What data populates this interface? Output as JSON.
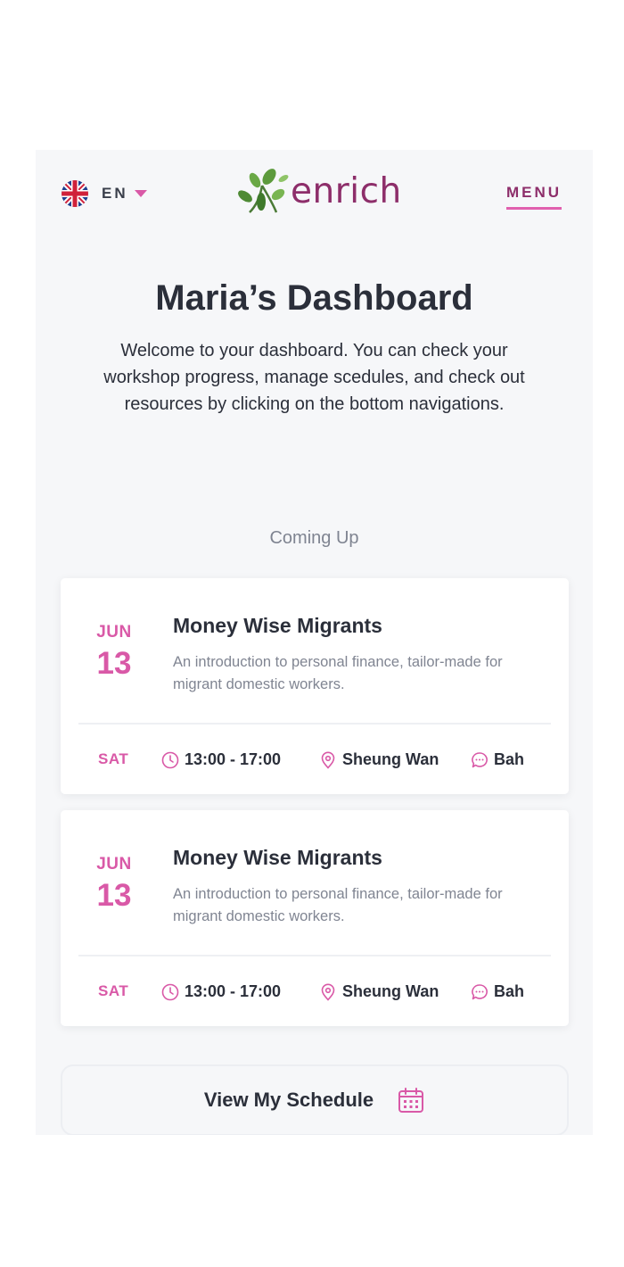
{
  "header": {
    "language_code": "EN",
    "logo_text": "enrich",
    "menu_label": "MENU"
  },
  "page": {
    "title": "Maria’s Dashboard",
    "subtitle": "Welcome to your dashboard. You can check your workshop progress, manage scedules, and check out resources by clicking on the bottom navigations.",
    "section_label": "Coming Up"
  },
  "events": [
    {
      "month": "JUN",
      "day": "13",
      "title": "Money Wise Migrants",
      "description": "An introduction to personal finance, tailor-made for migrant domestic workers.",
      "weekday": "SAT",
      "time": "13:00 - 17:00",
      "location": "Sheung Wan",
      "language": "Bah"
    },
    {
      "month": "JUN",
      "day": "13",
      "title": "Money Wise Migrants",
      "description": "An introduction to personal finance, tailor-made for migrant domestic workers.",
      "weekday": "SAT",
      "time": "13:00 - 17:00",
      "location": "Sheung Wan",
      "language": "Bah"
    }
  ],
  "schedule_button": {
    "label": "View My Schedule",
    "icon": "calendar-icon"
  },
  "colors": {
    "accent": "#d959a7",
    "brand": "#8d2e6a",
    "text": "#2b2f3a",
    "muted": "#808592",
    "background": "#f6f7f9"
  },
  "icons": {
    "language": "uk-flag-icon",
    "time": "clock-icon",
    "location": "location-pin-icon",
    "chat": "chat-bubble-icon"
  }
}
